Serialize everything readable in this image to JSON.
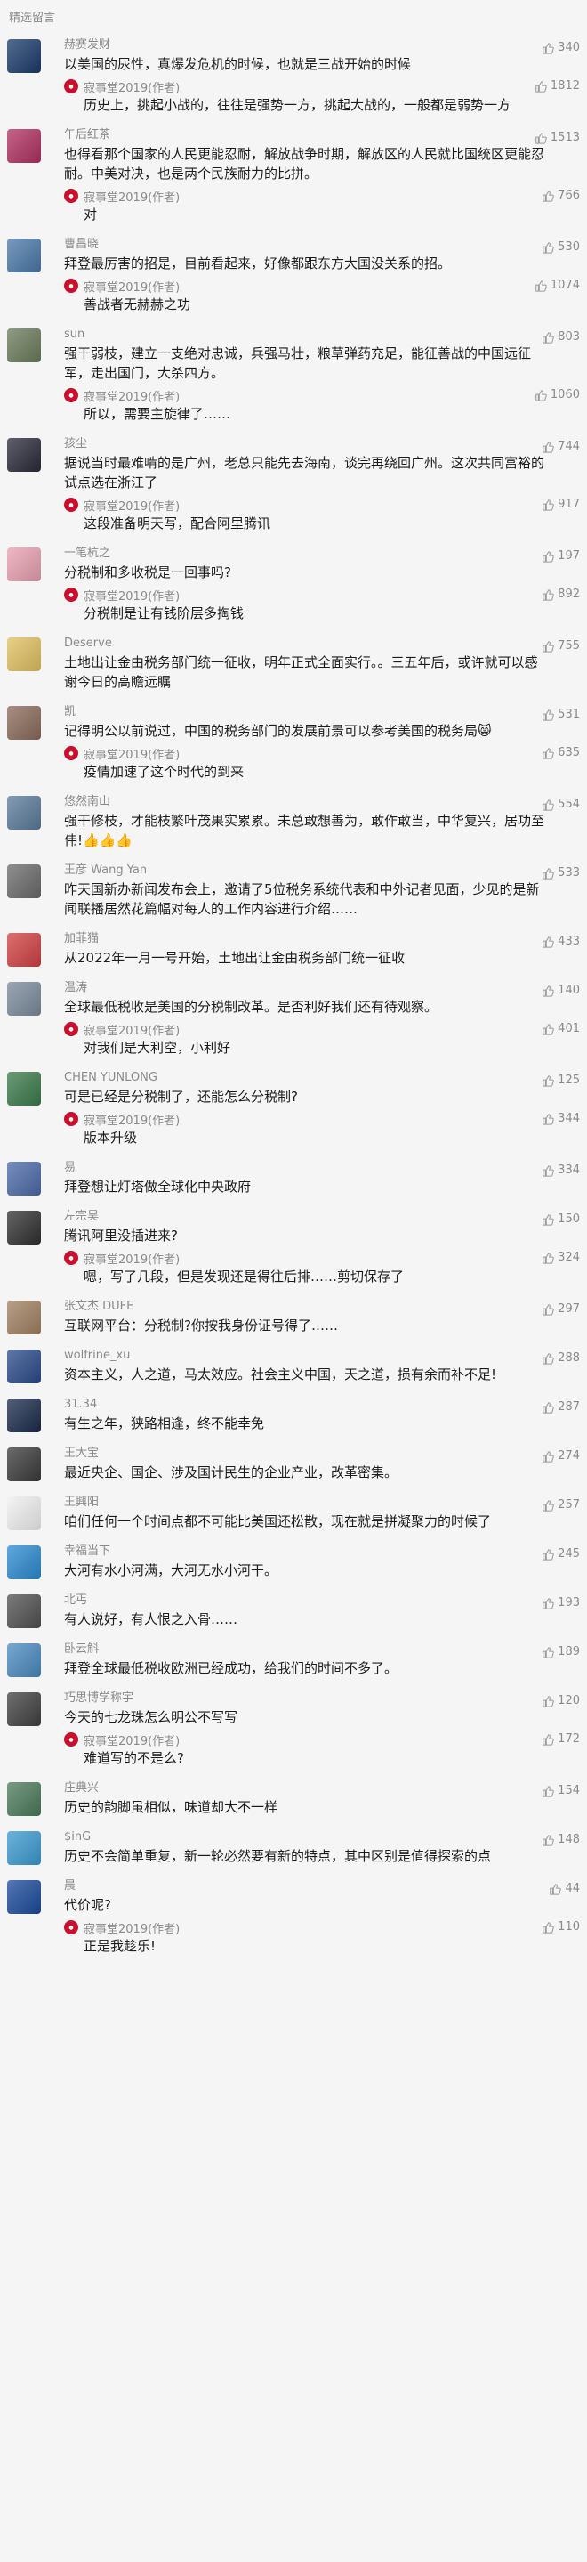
{
  "header": {
    "title": "精选留言"
  },
  "comments": [
    {
      "name": "赫赛发财",
      "avatar_color": "#1a3a6a",
      "likes": "340",
      "text": "以美国的尿性，真爆发危机的时候，也就是三战开始的时候",
      "reply": {
        "author": "寂事堂2019(作者)",
        "likes": "1812",
        "text": "历史上，挑起小战的，往往是强势一方，挑起大战的，一般都是弱势一方"
      }
    },
    {
      "name": "午后红茶",
      "avatar_color": "#b03060",
      "likes": "1513",
      "text": "也得看那个国家的人民更能忍耐，解放战争时期，解放区的人民就比国统区更能忍耐。中美对决，也是两个民族耐力的比拼。",
      "reply": {
        "author": "寂事堂2019(作者)",
        "likes": "766",
        "text": "对"
      }
    },
    {
      "name": "曹昌晓",
      "avatar_color": "#4a78a8",
      "likes": "530",
      "text": "拜登最厉害的招是，目前看起来，好像都跟东方大国没关系的招。",
      "reply": {
        "author": "寂事堂2019(作者)",
        "likes": "1074",
        "text": "善战者无赫赫之功"
      }
    },
    {
      "name": "sun",
      "avatar_color": "#6a7a5a",
      "likes": "803",
      "text": "强干弱枝，建立一支绝对忠诚，兵强马壮，粮草弹药充足，能征善战的中国远征军，走出国门，大杀四方。",
      "reply": {
        "author": "寂事堂2019(作者)",
        "likes": "1060",
        "text": "所以，需要主旋律了……"
      }
    },
    {
      "name": "孩尘",
      "avatar_color": "#2a2a3a",
      "likes": "744",
      "text": "据说当时最难啃的是广州，老总只能先去海南，谈完再绕回广州。这次共同富裕的试点选在浙江了",
      "reply": {
        "author": "寂事堂2019(作者)",
        "likes": "917",
        "text": "这段准备明天写，配合阿里腾讯"
      }
    },
    {
      "name": "一笔杭之",
      "avatar_color": "#e8a0b0",
      "likes": "197",
      "text": "分税制和多收税是一回事吗?",
      "reply": {
        "author": "寂事堂2019(作者)",
        "likes": "892",
        "text": "分税制是让有钱阶层多掏钱"
      }
    },
    {
      "name": "Deserve",
      "avatar_color": "#e0c060",
      "likes": "755",
      "text": "土地出让金由税务部门统一征收，明年正式全面实行。。三五年后，或许就可以感谢今日的高瞻远瞩",
      "reply": null
    },
    {
      "name": "凯",
      "avatar_color": "#8a6a5a",
      "likes": "531",
      "text": "记得明公以前说过，中国的税务部门的发展前景可以参考美国的税务局😸",
      "reply": {
        "author": "寂事堂2019(作者)",
        "likes": "635",
        "text": "疫情加速了这个时代的到来"
      }
    },
    {
      "name": "悠然南山",
      "avatar_color": "#5a7a9a",
      "likes": "554",
      "text": "强干修枝，才能枝繁叶茂果实累累。未总敢想善为，敢作敢当，中华复兴，居功至伟!👍👍👍",
      "reply": null
    },
    {
      "name": "王彦 Wang Yan",
      "avatar_color": "#6a6a6a",
      "likes": "533",
      "text": "昨天国新办新闻发布会上，邀请了5位税务系统代表和中外记者见面，少见的是新闻联播居然花篇幅对每人的工作内容进行介绍……",
      "reply": null
    },
    {
      "name": "加菲猫",
      "avatar_color": "#d04040",
      "likes": "433",
      "text": "从2022年一月一号开始，土地出让金由税务部门统一征收",
      "reply": null
    },
    {
      "name": "温涛",
      "avatar_color": "#7a8a9a",
      "likes": "140",
      "text": "全球最低税收是美国的分税制改革。是否利好我们还有待观察。",
      "reply": {
        "author": "寂事堂2019(作者)",
        "likes": "401",
        "text": "对我们是大利空，小利好"
      }
    },
    {
      "name": "CHEN YUNLONG",
      "avatar_color": "#3a7a4a",
      "likes": "125",
      "text": "可是已经是分税制了，还能怎么分税制?",
      "reply": {
        "author": "寂事堂2019(作者)",
        "likes": "344",
        "text": "版本升级"
      }
    },
    {
      "name": "易",
      "avatar_color": "#4a6aa8",
      "likes": "334",
      "text": "拜登想让灯塔做全球化中央政府",
      "reply": null
    },
    {
      "name": "左宗昊",
      "avatar_color": "#303030",
      "likes": "150",
      "text": "腾讯阿里没插进来?",
      "reply": {
        "author": "寂事堂2019(作者)",
        "likes": "324",
        "text": "嗯，写了几段，但是发现还是得往后排……剪切保存了"
      }
    },
    {
      "name": "张文杰 DUFE",
      "avatar_color": "#a08060",
      "likes": "297",
      "text": "互联网平台：分税制?你按我身份证号得了……",
      "reply": null
    },
    {
      "name": "wolfrine_xu",
      "avatar_color": "#2a4a8a",
      "likes": "288",
      "text": "资本主义，人之道，马太效应。社会主义中国，天之道，损有余而补不足!",
      "reply": null
    },
    {
      "name": "31.34",
      "avatar_color": "#1a2a4a",
      "likes": "287",
      "text": "有生之年，狭路相逢，终不能幸免",
      "reply": null
    },
    {
      "name": "王大宝",
      "avatar_color": "#3a3a3a",
      "likes": "274",
      "text": "最近央企、国企、涉及国计民生的企业产业，改革密集。",
      "reply": null
    },
    {
      "name": "王興阳",
      "avatar_color": "#f0f0f0",
      "likes": "257",
      "text": "咱们任何一个时间点都不可能比美国还松散，现在就是拼凝聚力的时候了",
      "reply": null
    },
    {
      "name": "幸福当下",
      "avatar_color": "#2a8ad0",
      "likes": "245",
      "text": "大河有水小河满，大河无水小河干。",
      "reply": null
    },
    {
      "name": "北丐",
      "avatar_color": "#505050",
      "likes": "193",
      "text": "有人说好，有人恨之入骨……",
      "reply": null
    },
    {
      "name": "卧云斛",
      "avatar_color": "#4a8ac0",
      "likes": "189",
      "text": "拜登全球最低税收欧洲已经成功，给我们的时间不多了。",
      "reply": null
    },
    {
      "name": "巧思博学称宇",
      "avatar_color": "#404040",
      "likes": "120",
      "text": "今天的七龙珠怎么明公不写写",
      "reply": {
        "author": "寂事堂2019(作者)",
        "likes": "172",
        "text": "难道写的不是么?"
      }
    },
    {
      "name": "庄典兴",
      "avatar_color": "#4a7a5a",
      "likes": "154",
      "text": "历史的韵脚虽相似，味道却大不一样",
      "reply": null
    },
    {
      "name": "$inG",
      "avatar_color": "#3a9ad0",
      "likes": "148",
      "text": "历史不会简单重复，新一轮必然要有新的特点，其中区别是值得探索的点",
      "reply": null
    },
    {
      "name": "晨",
      "avatar_color": "#1a4a9a",
      "likes": "44",
      "text": "代价呢?",
      "reply": {
        "author": "寂事堂2019(作者)",
        "likes": "110",
        "text": "正是我趁乐!"
      }
    }
  ]
}
